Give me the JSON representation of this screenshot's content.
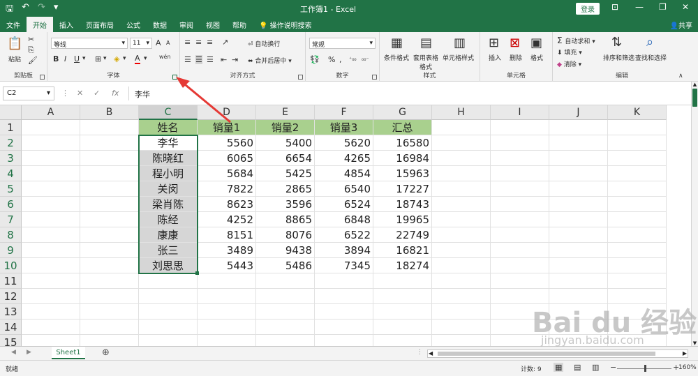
{
  "app": {
    "title": "工作簿1  -  Excel",
    "login": "登录",
    "share": "共享"
  },
  "menu": [
    "文件",
    "开始",
    "插入",
    "页面布局",
    "公式",
    "数据",
    "审阅",
    "视图",
    "帮助",
    "操作说明搜索"
  ],
  "ribbon": {
    "clipboard": {
      "paste": "粘贴",
      "label": "剪贴板"
    },
    "font": {
      "name": "等线",
      "size": "11",
      "label": "字体",
      "size_up": "A",
      "size_down": "A",
      "wen": "wén"
    },
    "alignment": {
      "wrap": "自动换行",
      "merge": "合并后居中",
      "label": "对齐方式"
    },
    "number": {
      "format": "常规",
      "label": "数字"
    },
    "styles": {
      "cond": "条件格式",
      "table": "套用表格格式",
      "cell": "单元格样式",
      "label": "样式"
    },
    "cells": {
      "insert": "插入",
      "delete": "删除",
      "format": "格式",
      "label": "单元格"
    },
    "editing": {
      "autosum": "自动求和",
      "fill": "填充",
      "clear": "清除",
      "sort": "排序和筛选",
      "find": "查找和选择",
      "label": "编辑"
    }
  },
  "formula_bar": {
    "name_box": "C2",
    "formula": "李华"
  },
  "columns": [
    "A",
    "B",
    "C",
    "D",
    "E",
    "F",
    "G",
    "H",
    "I",
    "J",
    "K"
  ],
  "rows": [
    "1",
    "2",
    "3",
    "4",
    "5",
    "6",
    "7",
    "8",
    "9",
    "10",
    "11",
    "12",
    "13",
    "14",
    "15"
  ],
  "table": {
    "headers": [
      "姓名",
      "销量1",
      "销量2",
      "销量3",
      "汇总"
    ],
    "rows": [
      [
        "李华",
        "5560",
        "5400",
        "5620",
        "16580"
      ],
      [
        "陈晓红",
        "6065",
        "6654",
        "4265",
        "16984"
      ],
      [
        "程小明",
        "5684",
        "5425",
        "4854",
        "15963"
      ],
      [
        "关闵",
        "7822",
        "2865",
        "6540",
        "17227"
      ],
      [
        "梁肖陈",
        "8623",
        "3596",
        "6524",
        "18743"
      ],
      [
        "陈经",
        "4252",
        "8865",
        "6848",
        "19965"
      ],
      [
        "康康",
        "8151",
        "8076",
        "6522",
        "22749"
      ],
      [
        "张三",
        "3489",
        "9438",
        "3894",
        "16821"
      ],
      [
        "刘思思",
        "5443",
        "5486",
        "7345",
        "18274"
      ]
    ]
  },
  "sheet_tab": "Sheet1",
  "status": {
    "ready": "就绪",
    "count": "计数: 9",
    "zoom": "160%"
  },
  "watermark": {
    "main": "Bai du 经验",
    "sub": "jingyan.baidu.com"
  },
  "colors": {
    "accent": "#217346",
    "header_fill": "#a9d08e",
    "arrow": "#e53935"
  }
}
